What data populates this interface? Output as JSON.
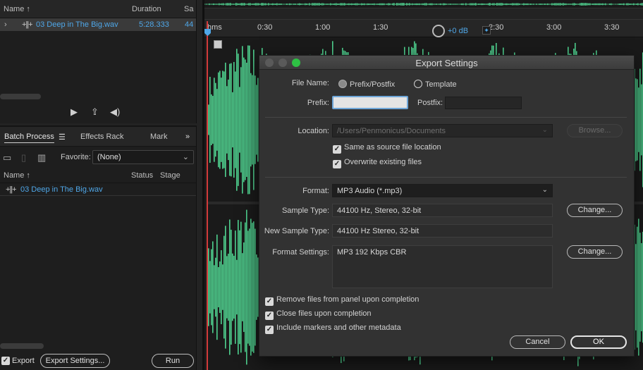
{
  "files_panel": {
    "columns": {
      "name": "Name ↑",
      "duration": "Duration",
      "sample_rate": "Sa"
    },
    "file": {
      "name": "03 Deep in The Big.wav",
      "duration": "5:28.333",
      "sample_rate": "44"
    }
  },
  "batch_panel": {
    "tabs": {
      "batch": "Batch Process",
      "effects": "Effects Rack",
      "markers": "Mark"
    },
    "favorite_label": "Favorite:",
    "favorite_value": "(None)",
    "columns": {
      "name": "Name ↑",
      "status": "Status",
      "stage": "Stage"
    },
    "file": {
      "name": "03 Deep in The Big.wav"
    },
    "export_label": "Export",
    "export_settings_button": "Export Settings...",
    "run_button": "Run"
  },
  "ruler": {
    "ticks": [
      "hms",
      "0:30",
      "1:00",
      "1:30",
      "2:30",
      "3:00",
      "3:30"
    ],
    "gain": "+0 dB"
  },
  "dialog": {
    "title": "Export Settings",
    "file_name_label": "File Name:",
    "radio_prefix": "Prefix/Postfix",
    "radio_template": "Template",
    "prefix_label": "Prefix:",
    "prefix_value": "",
    "postfix_label": "Postfix:",
    "postfix_value": "",
    "location_label": "Location:",
    "location_value": "/Users/Penmonicus/Documents",
    "browse_button": "Browse...",
    "same_as_source": "Same as source file location",
    "overwrite": "Overwrite existing files",
    "format_label": "Format:",
    "format_value": "MP3 Audio (*.mp3)",
    "sample_type_label": "Sample Type:",
    "sample_type_value": "44100 Hz, Stereo, 32-bit",
    "new_sample_type_label": "New Sample Type:",
    "new_sample_type_value": "44100 Hz Stereo, 32-bit",
    "change_button": "Change...",
    "format_settings_label": "Format Settings:",
    "format_settings_value": "MP3 192 Kbps CBR",
    "remove_files": "Remove files from panel upon completion",
    "close_files": "Close files upon completion",
    "include_markers": "Include markers and other metadata",
    "cancel_button": "Cancel",
    "ok_button": "OK"
  },
  "colors": {
    "waveform": "#4fd18f",
    "selected_blue": "#4fa7e8",
    "playhead": "#d23a3a"
  },
  "icons": [
    "chevron-right-icon",
    "waveform-icon",
    "play-icon",
    "export-icon",
    "speaker-icon",
    "panel-menu-icon",
    "expand-icon",
    "folder-icon",
    "trash-icon",
    "trash-all-icon",
    "gain-knob-icon",
    "pin-icon",
    "checkbox-icon",
    "radio-icon",
    "dropdown-caret-icon"
  ]
}
